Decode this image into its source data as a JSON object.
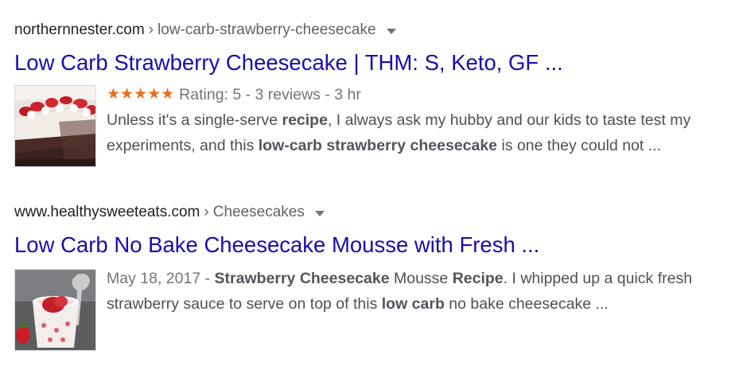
{
  "results": [
    {
      "domain": "northernnester.com",
      "separator": "›",
      "path": "low-carb-strawberry-cheesecake",
      "title": "Low Carb Strawberry Cheesecake | THM: S, Keto, GF ...",
      "rating_stars": "★★★★★",
      "rating_text": "Rating: 5 - 3 reviews - 3 hr",
      "snippet": {
        "l1_a": "Unless it's a single-serve ",
        "l1_b": "recipe",
        "l1_c": ", I always ask my hubby and our kids to taste test my",
        "l2_a": "experiments, and this ",
        "l2_b": "low-carb strawberry cheesecake",
        "l2_c": " is one they could not ..."
      },
      "thumbnail_icon": "strawberry-cheesecake-photo"
    },
    {
      "domain": "www.healthysweeteats.com",
      "separator": "›",
      "path": "Cheesecakes",
      "title": "Low Carb No Bake Cheesecake Mousse with Fresh ...",
      "date": "May 18, 2017",
      "date_sep": " - ",
      "snippet": {
        "l1_a": "Strawberry Cheesecake",
        "l1_b": " Mousse ",
        "l1_c": "Recipe",
        "l1_d": ". I whipped up a quick fresh",
        "l2_a": "strawberry sauce to serve on top of this ",
        "l2_b": "low carb",
        "l2_c": " no bake cheesecake ..."
      },
      "thumbnail_icon": "cheesecake-mousse-cup-photo"
    }
  ],
  "colors": {
    "title_link": "#1a0dab",
    "domain": "#202124",
    "snippet": "#4d5156",
    "stars": "#e7711b"
  }
}
